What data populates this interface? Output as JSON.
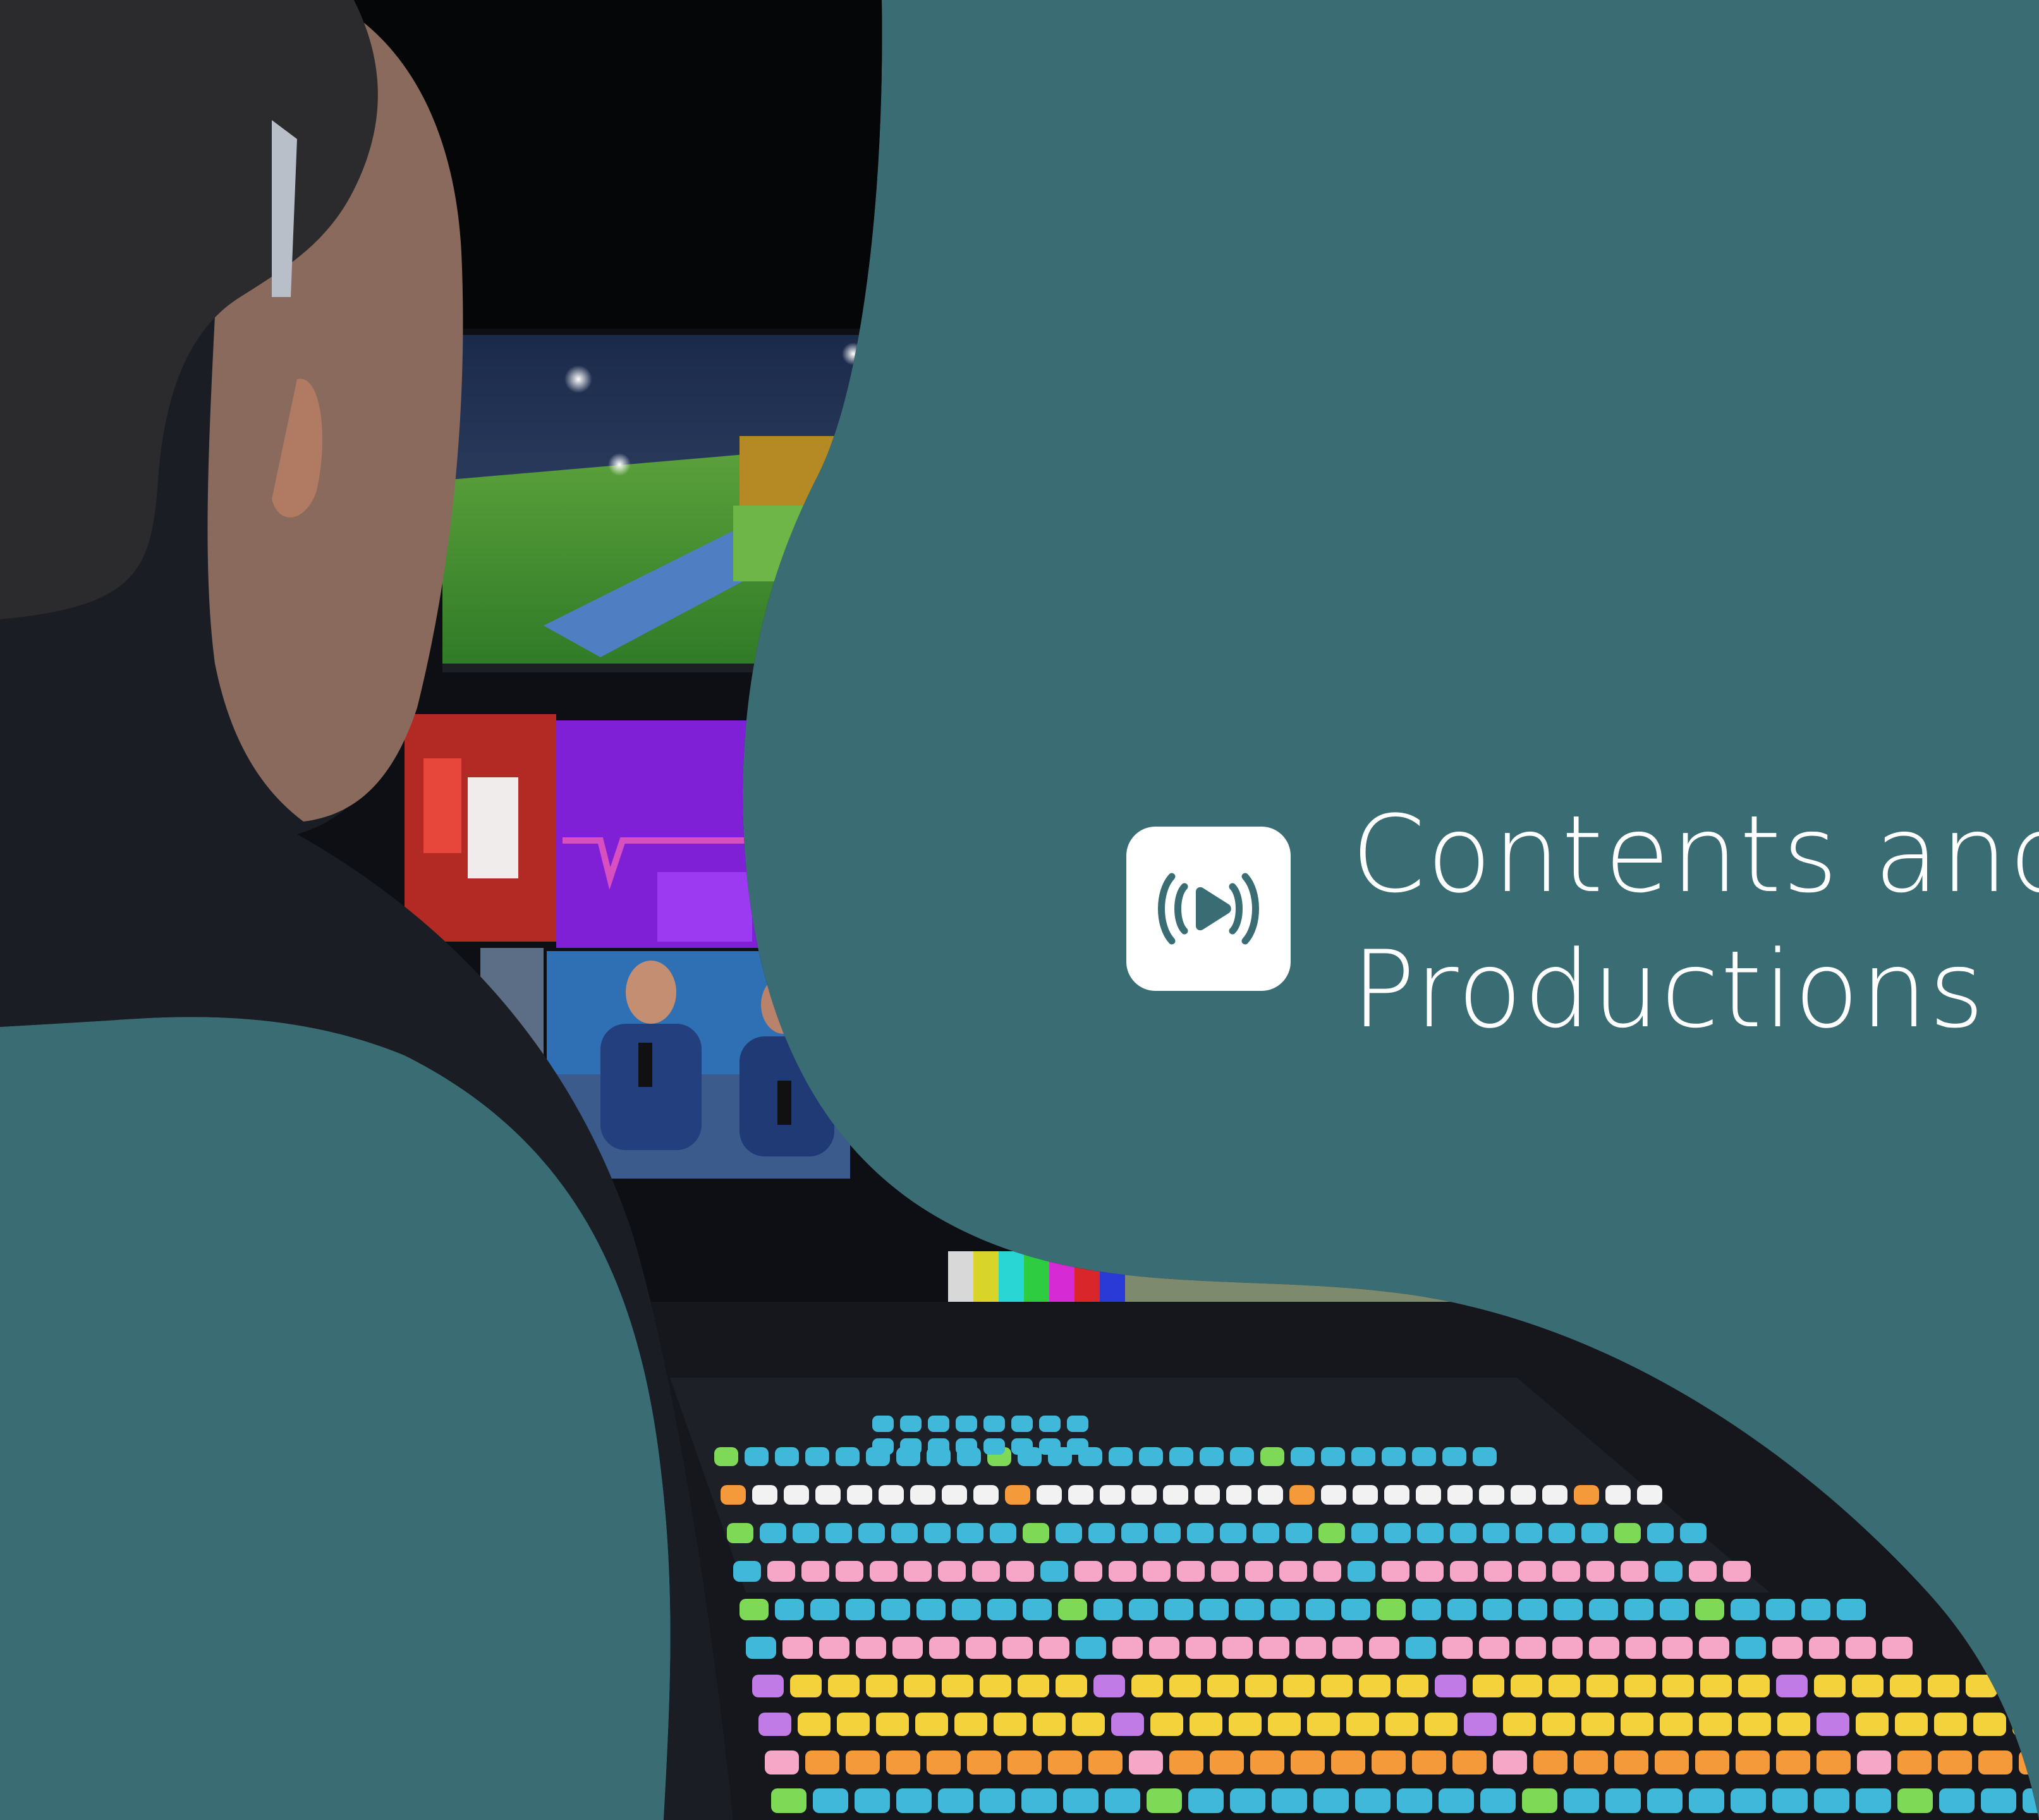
{
  "heading": {
    "line1": "Contents and",
    "line2": "Productions"
  },
  "icon": {
    "name": "live-broadcast-icon"
  },
  "colors": {
    "background_teal": "#396c73",
    "text": "#ffffff",
    "icon_tile": "#ffffff",
    "icon_glyph": "#396c73",
    "photo_dark": "#0d0f14"
  }
}
